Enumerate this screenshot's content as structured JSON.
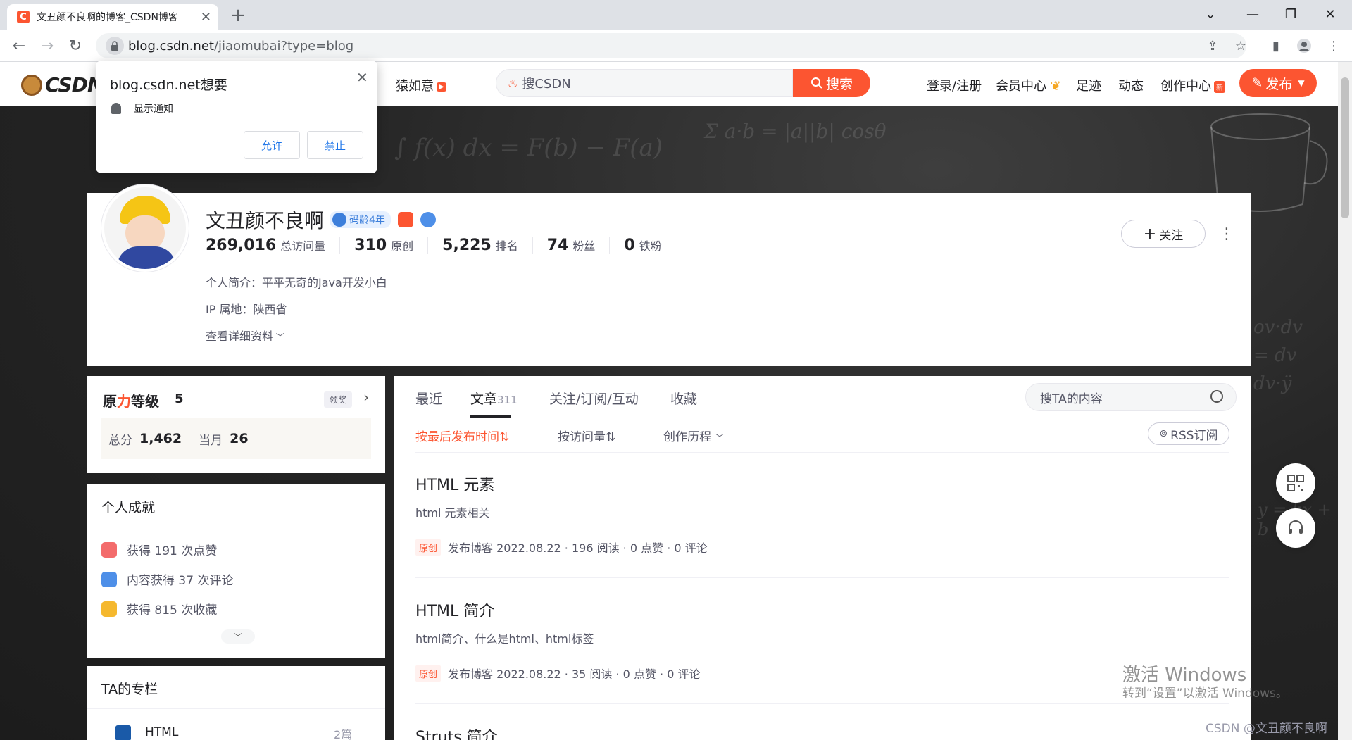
{
  "browser": {
    "tab_title": "文丑颜不良啊的博客_CSDN博客",
    "url_host": "blog.csdn.net",
    "url_path": "/jiaomubai?type=blog"
  },
  "popup": {
    "title": "blog.csdn.net想要",
    "permission": "显示通知",
    "allow": "允许",
    "block": "禁止"
  },
  "header": {
    "logo": "CSDN",
    "link_yuanruyi": "猿如意",
    "search_placeholder": "搜CSDN",
    "search_button": "搜索",
    "login": "登录/注册",
    "vip": "会员中心",
    "footprint": "足迹",
    "dynamics": "动态",
    "creation": "创作中心",
    "publish": "发布"
  },
  "profile": {
    "name": "文丑颜不良啊",
    "code_age": "码龄4年",
    "stats": [
      {
        "num": "269,016",
        "label": "总访问量"
      },
      {
        "num": "310",
        "label": "原创"
      },
      {
        "num": "5,225",
        "label": "排名"
      },
      {
        "num": "74",
        "label": "粉丝"
      },
      {
        "num": "0",
        "label": "铁粉"
      }
    ],
    "intro": "个人简介：平平无奇的Java开发小白",
    "ip": "IP 属地：陕西省",
    "more": "查看详细资料",
    "follow": "关注"
  },
  "level": {
    "title_a": "原",
    "title_b": "力",
    "title_c": "等级",
    "num": "5",
    "claim": "领奖",
    "total_label": "总分",
    "total": "1,462",
    "month_label": "当月",
    "month": "26"
  },
  "achievements": {
    "title": "个人成就",
    "items": [
      "获得 191 次点赞",
      "内容获得 37 次评论",
      "获得 815 次收藏"
    ]
  },
  "columns": {
    "title": "TA的专栏",
    "first_item": "HTML",
    "first_count": "2篇"
  },
  "main": {
    "tabs": [
      "最近",
      "文章",
      "关注/订阅/互动",
      "收藏"
    ],
    "article_count": "311",
    "search_placeholder": "搜TA的内容",
    "sorts": [
      "按最后发布时间⇅",
      "按访问量⇅",
      "创作历程"
    ],
    "rss": "RSS订阅",
    "articles": [
      {
        "title": "HTML 元素",
        "desc": "html 元素相关",
        "tag": "原创",
        "meta": "发布博客 2022.08.22 · 196 阅读 · 0 点赞 · 0 评论"
      },
      {
        "title": "HTML 简介",
        "desc": "html简介、什么是html、html标签",
        "tag": "原创",
        "meta": "发布博客 2022.08.22 · 35 阅读 · 0 点赞 · 0 评论"
      },
      {
        "title": "Struts 简介"
      }
    ]
  },
  "watermark": {
    "line1": "激活 Windows",
    "line2": "转到“设置”以激活 Windows。",
    "csdn": "CSDN @文丑颜不良啊"
  },
  "colors": {
    "accent": "#fc5531",
    "link_blue": "#1a73e8"
  }
}
